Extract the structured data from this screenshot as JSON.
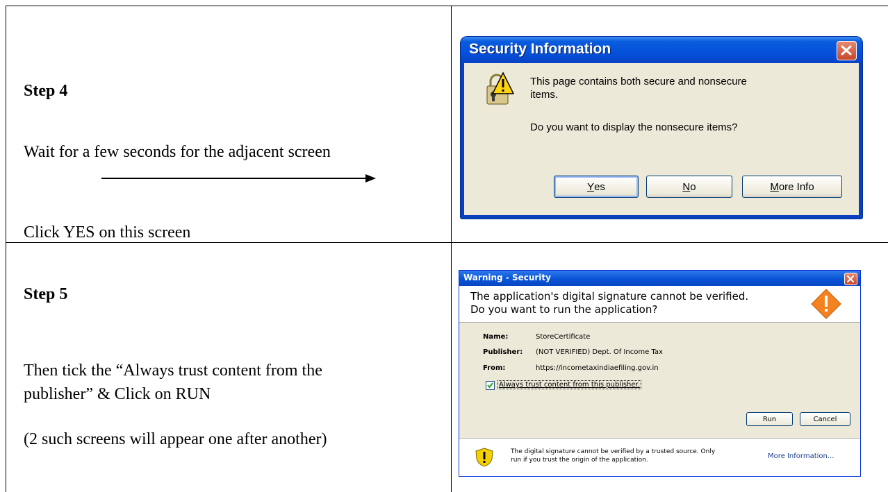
{
  "steps": [
    {
      "title": "Step 4",
      "lines": [
        "Wait for a few seconds for the adjacent screen",
        "Click YES on this screen"
      ]
    },
    {
      "title": "Step 5",
      "lines": [
        "Then tick the “Always trust content from the",
        "publisher” & Click on RUN",
        "(2 such screens will appear one after another)"
      ]
    }
  ],
  "dialog1": {
    "title": "Security Information",
    "message_line1": "This page contains both secure and nonsecure",
    "message_line2": "items.",
    "question": "Do you want to display the nonsecure items?",
    "buttons": [
      {
        "mnemonic": "Y",
        "rest": "es"
      },
      {
        "mnemonic": "N",
        "rest": "o"
      },
      {
        "mnemonic": "M",
        "rest": "ore Info"
      }
    ],
    "close_icon": "close-icon",
    "warning_icon": "lock-warning-icon"
  },
  "dialog2": {
    "title": "Warning - Security",
    "header_line1": "The application's digital signature cannot be verified.",
    "header_line2": "Do you want to run the application?",
    "fields": [
      {
        "label": "Name:",
        "value": "StoreCertificate"
      },
      {
        "label": "Publisher:",
        "value": "(NOT VERIFIED) Dept. Of Income Tax"
      },
      {
        "label": "From:",
        "value": "https://incometaxindiaefiling.gov.in"
      }
    ],
    "checkbox_label": "Always trust content from this publisher.",
    "checkbox_checked": true,
    "run_label": "Run",
    "cancel_label": "Cancel",
    "footer_line1": "The digital signature cannot be verified by a trusted source.  Only",
    "footer_line2": "run if you trust the origin of the application.",
    "more_info": "More Information...",
    "close_icon": "close-icon",
    "warning_icon": "warning-diamond-icon",
    "shield_icon": "shield-warning-icon"
  },
  "colors": {
    "xp_title": "#0551dc",
    "xp_face": "#ece9d8",
    "warning_orange": "#f58220",
    "shield_yellow": "#f5d000"
  }
}
